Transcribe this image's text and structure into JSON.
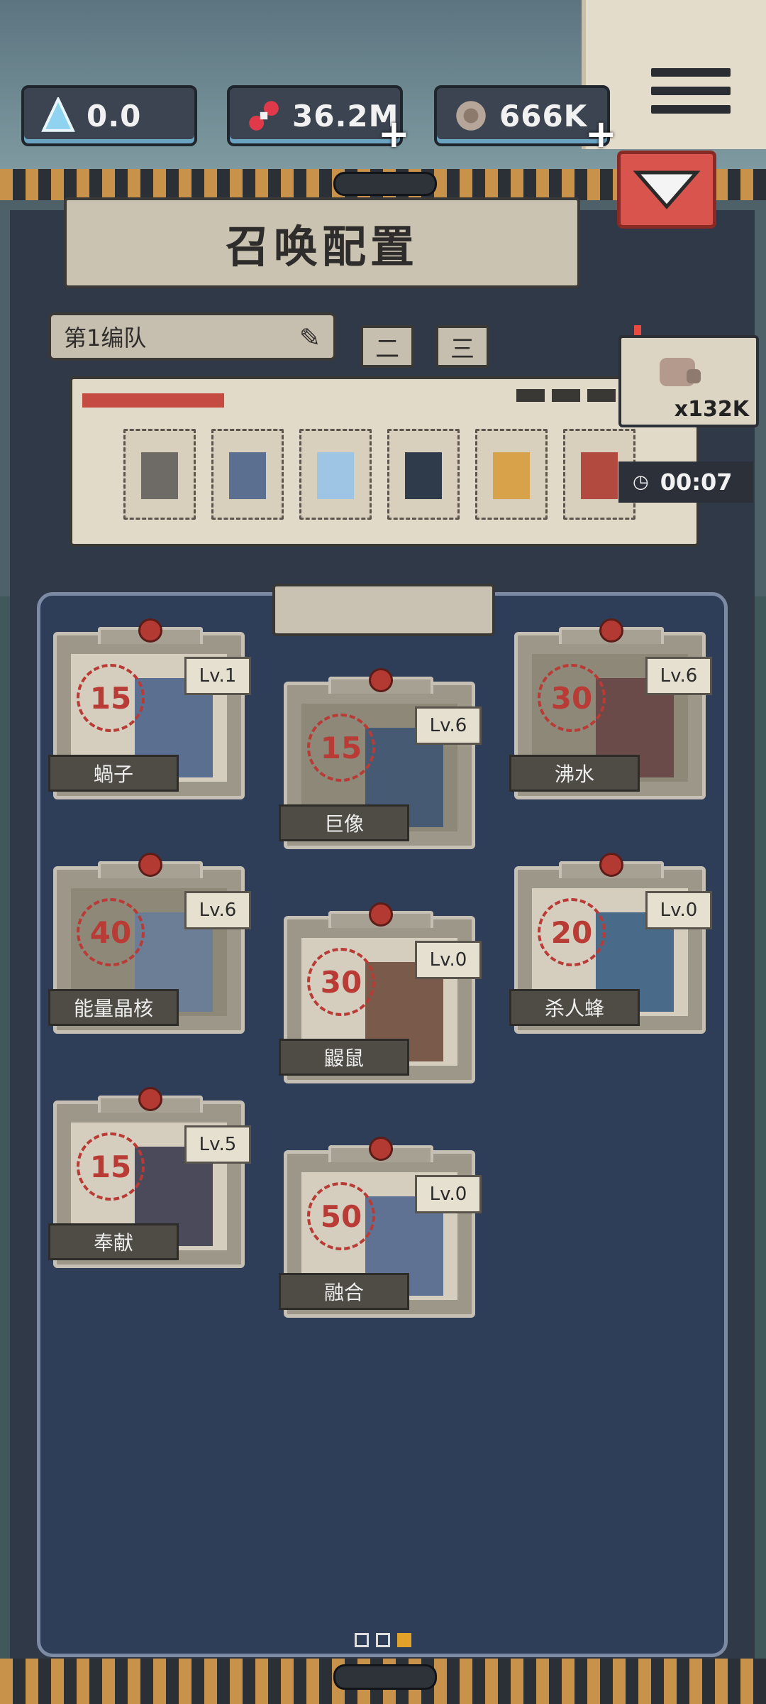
{
  "resources": [
    {
      "id": "crystal",
      "value": "0.0",
      "icon": "crystal-icon",
      "has_plus": false
    },
    {
      "id": "dna",
      "value": "36.2M",
      "icon": "dna-icon",
      "has_plus": true
    },
    {
      "id": "meat",
      "value": "666K",
      "icon": "meat-icon",
      "has_plus": true
    }
  ],
  "title": "召唤配置",
  "team": {
    "selected": "第1编队",
    "tabs": [
      "二",
      "三"
    ]
  },
  "reward": {
    "count": "x132K",
    "icon": "meat-bag-icon"
  },
  "timer": {
    "value": "00:07"
  },
  "lineup_mobs": [
    "mob-1",
    "mob-2",
    "mob-3",
    "mob-4",
    "mob-5",
    "mob-6"
  ],
  "cards": [
    {
      "name": "蝸子",
      "cost": "15",
      "level": "Lv.1",
      "dim": false
    },
    {
      "name": "巨像",
      "cost": "15",
      "level": "Lv.6",
      "dim": true
    },
    {
      "name": "沸水",
      "cost": "30",
      "level": "Lv.6",
      "dim": true
    },
    {
      "name": "能量晶核",
      "cost": "40",
      "level": "Lv.6",
      "dim": true
    },
    {
      "name": "鼹鼠",
      "cost": "30",
      "level": "Lv.0",
      "dim": false
    },
    {
      "name": "杀人蜂",
      "cost": "20",
      "level": "Lv.0",
      "dim": false
    },
    {
      "name": "奉献",
      "cost": "15",
      "level": "Lv.5",
      "dim": false
    },
    {
      "name": "融合",
      "cost": "50",
      "level": "Lv.0",
      "dim": false
    }
  ],
  "pager": {
    "total": 3,
    "active": 3
  },
  "colors": {
    "accent": "#d9544c",
    "panel": "#2e3d58",
    "cost": "#b93b35",
    "stripe": "#c8924a"
  }
}
